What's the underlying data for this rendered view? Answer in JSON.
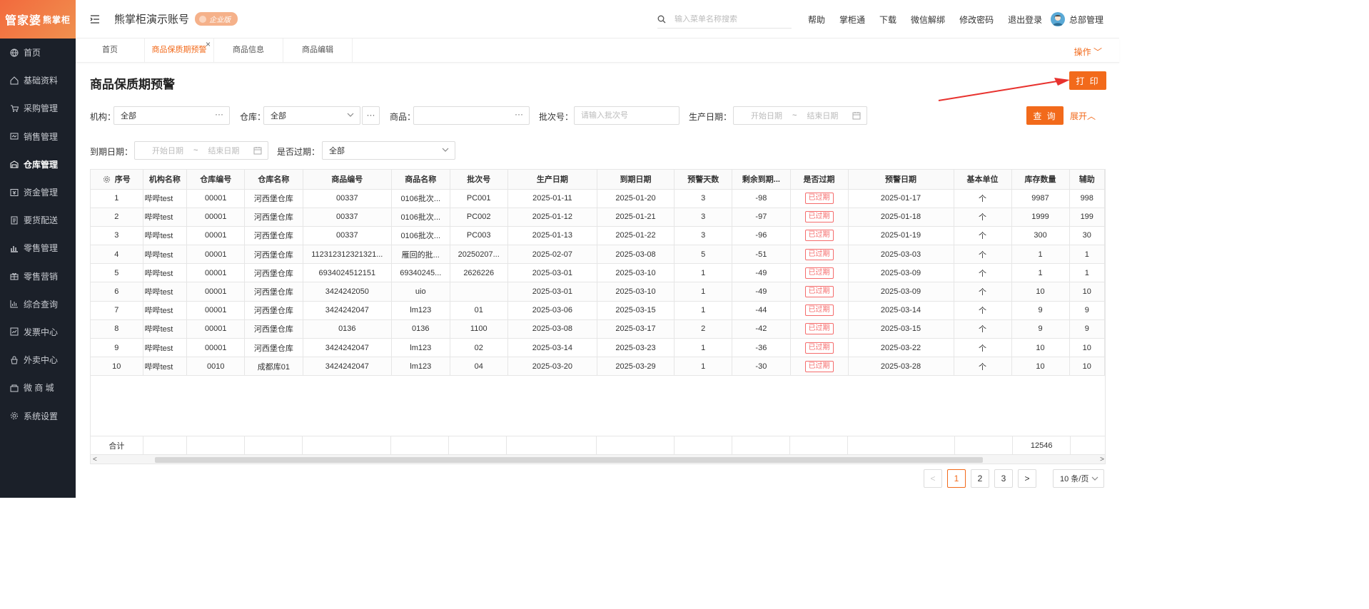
{
  "logo": {
    "main": "管家婆",
    "sub": "熊掌柜"
  },
  "sidebar": {
    "items": [
      {
        "label": "首页",
        "icon": "globe-icon"
      },
      {
        "label": "基础资料",
        "icon": "home-icon"
      },
      {
        "label": "采购管理",
        "icon": "cart-icon"
      },
      {
        "label": "销售管理",
        "icon": "sales-icon"
      },
      {
        "label": "仓库管理",
        "icon": "warehouse-icon"
      },
      {
        "label": "资金管理",
        "icon": "finance-icon"
      },
      {
        "label": "要货配送",
        "icon": "delivery-icon"
      },
      {
        "label": "零售管理",
        "icon": "retail-chart-icon"
      },
      {
        "label": "零售营销",
        "icon": "gift-icon"
      },
      {
        "label": "综合查询",
        "icon": "bar-chart-icon"
      },
      {
        "label": "发票中心",
        "icon": "invoice-icon"
      },
      {
        "label": "外卖中心",
        "icon": "takeout-icon"
      },
      {
        "label": "微 商 城",
        "icon": "shop-icon"
      },
      {
        "label": "系统设置",
        "icon": "gear-icon"
      }
    ],
    "active_index": 4
  },
  "header": {
    "account_name": "熊掌柜演示账号",
    "edition_badge": "企业版",
    "search_placeholder": "输入菜单名称搜索",
    "links": [
      "帮助",
      "掌柜通",
      "下载",
      "微信解绑",
      "修改密码",
      "退出登录"
    ],
    "user_name": "总部管理"
  },
  "tabs": [
    {
      "label": "首页"
    },
    {
      "label": "商品保质期预警",
      "active": true,
      "close": "×"
    },
    {
      "label": "商品信息"
    },
    {
      "label": "商品编辑"
    }
  ],
  "ops_label": "操作",
  "page": {
    "title": "商品保质期预警",
    "print_label": "打 印",
    "query_label": "查 询",
    "expand_label": "展开"
  },
  "filters": {
    "org": {
      "label": "机构：",
      "value": "全部"
    },
    "warehouse": {
      "label": "仓库：",
      "value": "全部"
    },
    "product": {
      "label": "商品：",
      "value": ""
    },
    "batch": {
      "label": "批次号：",
      "placeholder": "请输入批次号"
    },
    "prod_date": {
      "label": "生产日期：",
      "start": "开始日期",
      "sep": "~",
      "end": "结束日期"
    },
    "due_date": {
      "label": "到期日期：",
      "start": "开始日期",
      "sep": "~",
      "end": "结束日期"
    },
    "expired": {
      "label": "是否过期：",
      "value": "全部"
    }
  },
  "table": {
    "columns": [
      "序号",
      "机构名称",
      "仓库编号",
      "仓库名称",
      "商品编号",
      "商品名称",
      "批次号",
      "生产日期",
      "到期日期",
      "预警天数",
      "剩余到期...",
      "是否过期",
      "预警日期",
      "基本单位",
      "库存数量",
      "辅助"
    ],
    "rows": [
      [
        "1",
        "哔哔test",
        "00001",
        "河西堡仓库",
        "00337",
        "0106批次...",
        "PC001",
        "2025-01-11",
        "2025-01-20",
        "3",
        "-98",
        "已过期",
        "2025-01-17",
        "个",
        "9987",
        "998"
      ],
      [
        "2",
        "哔哔test",
        "00001",
        "河西堡仓库",
        "00337",
        "0106批次...",
        "PC002",
        "2025-01-12",
        "2025-01-21",
        "3",
        "-97",
        "已过期",
        "2025-01-18",
        "个",
        "1999",
        "199"
      ],
      [
        "3",
        "哔哔test",
        "00001",
        "河西堡仓库",
        "00337",
        "0106批次...",
        "PC003",
        "2025-01-13",
        "2025-01-22",
        "3",
        "-96",
        "已过期",
        "2025-01-19",
        "个",
        "300",
        "30"
      ],
      [
        "4",
        "哔哔test",
        "00001",
        "河西堡仓库",
        "112312312321321...",
        "雁回的批...",
        "20250207...",
        "2025-02-07",
        "2025-03-08",
        "5",
        "-51",
        "已过期",
        "2025-03-03",
        "个",
        "1",
        "1"
      ],
      [
        "5",
        "哔哔test",
        "00001",
        "河西堡仓库",
        "6934024512151",
        "69340245...",
        "2626226",
        "2025-03-01",
        "2025-03-10",
        "1",
        "-49",
        "已过期",
        "2025-03-09",
        "个",
        "1",
        "1"
      ],
      [
        "6",
        "哔哔test",
        "00001",
        "河西堡仓库",
        "3424242050",
        "uio",
        "",
        "2025-03-01",
        "2025-03-10",
        "1",
        "-49",
        "已过期",
        "2025-03-09",
        "个",
        "10",
        "10"
      ],
      [
        "7",
        "哔哔test",
        "00001",
        "河西堡仓库",
        "3424242047",
        "lm123",
        "01",
        "2025-03-06",
        "2025-03-15",
        "1",
        "-44",
        "已过期",
        "2025-03-14",
        "个",
        "9",
        "9"
      ],
      [
        "8",
        "哔哔test",
        "00001",
        "河西堡仓库",
        "0136",
        "0136",
        "1100",
        "2025-03-08",
        "2025-03-17",
        "2",
        "-42",
        "已过期",
        "2025-03-15",
        "个",
        "9",
        "9"
      ],
      [
        "9",
        "哔哔test",
        "00001",
        "河西堡仓库",
        "3424242047",
        "lm123",
        "02",
        "2025-03-14",
        "2025-03-23",
        "1",
        "-36",
        "已过期",
        "2025-03-22",
        "个",
        "10",
        "10"
      ],
      [
        "10",
        "哔哔test",
        "0010",
        "成都库01",
        "3424242047",
        "lm123",
        "04",
        "2025-03-20",
        "2025-03-29",
        "1",
        "-30",
        "已过期",
        "2025-03-28",
        "个",
        "10",
        "10"
      ]
    ],
    "footer_label": "合计",
    "footer_stock_total": "12546"
  },
  "pagination": {
    "pages": [
      "1",
      "2",
      "3"
    ],
    "current": "1",
    "page_size": "10 条/页"
  },
  "colors": {
    "accent": "#f26a1b",
    "sidebar_bg": "#1b2029",
    "expired": "#f56c6c"
  }
}
